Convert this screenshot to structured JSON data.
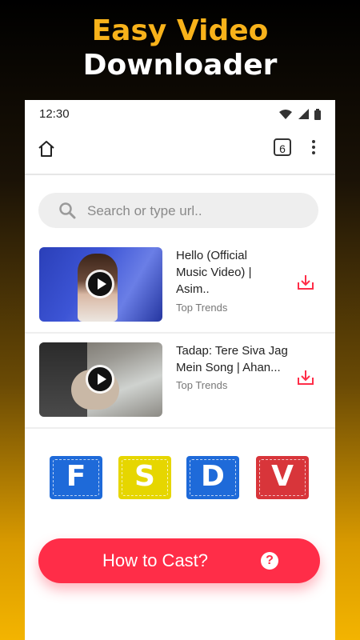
{
  "promo": {
    "line1": "Easy Video",
    "line2": "Downloader"
  },
  "status_bar": {
    "time": "12:30",
    "icons": [
      "wifi-icon",
      "signal-icon",
      "battery-icon"
    ]
  },
  "toolbar": {
    "home_icon": "home-icon",
    "tab_count": "6",
    "menu_icon": "more-vert-icon"
  },
  "search": {
    "placeholder": "Search or type url..",
    "icon": "search-icon"
  },
  "videos": [
    {
      "title_line1": "Hello (Official",
      "title_line2": "Music Video) |",
      "title_line3": "Asim..",
      "category": "Top Trends",
      "action_icon": "download-icon"
    },
    {
      "title_line1": "Tadap: Tere Siva Jag",
      "title_line2": "Mein Song | Ahan...",
      "category": "Top Trends",
      "action_icon": "download-icon"
    }
  ],
  "badges": [
    {
      "letter": "F",
      "color": "#1e6ad9"
    },
    {
      "letter": "S",
      "color": "#e6d600"
    },
    {
      "letter": "D",
      "color": "#1e6ad9"
    },
    {
      "letter": "V",
      "color": "#d8353a"
    }
  ],
  "cast": {
    "label": "How to Cast?",
    "help_symbol": "?"
  },
  "colors": {
    "accent": "#ff2d48",
    "promo_yellow": "#f8b21a"
  }
}
